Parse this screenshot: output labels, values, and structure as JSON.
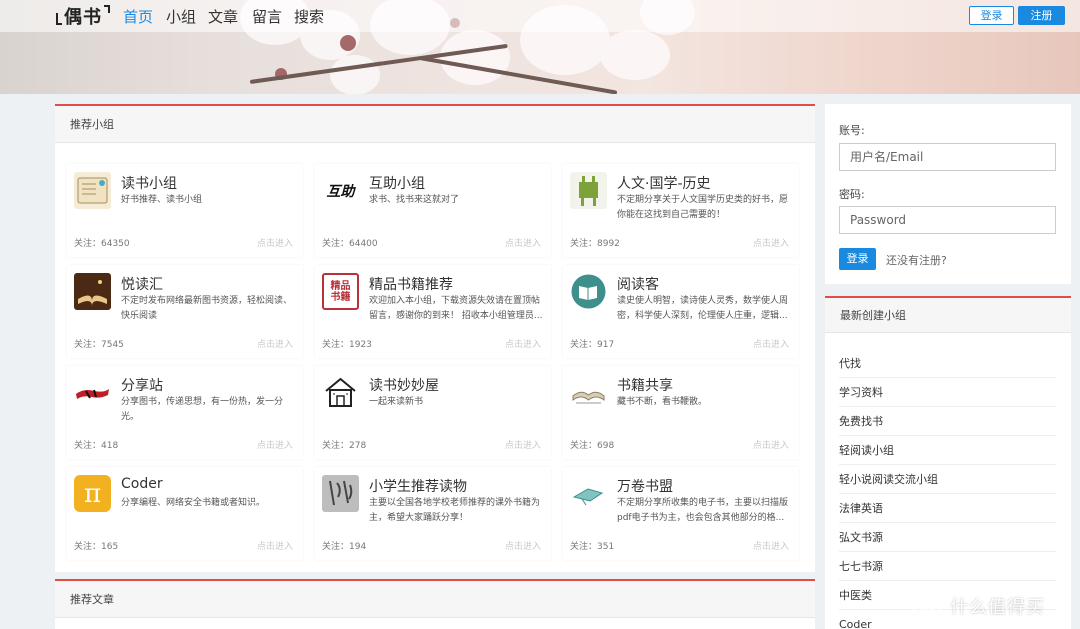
{
  "header": {
    "logo_text": "偶书",
    "nav": [
      "首页",
      "小组",
      "文章",
      "留言",
      "搜索"
    ],
    "login_label": "登录",
    "register_label": "注册"
  },
  "groups_panel": {
    "title": "推荐小组",
    "cards": [
      {
        "name": "读书小组",
        "desc": "好书推荐、读书小组",
        "follow": "关注：64350",
        "enter": "点击进入",
        "icon": "book-open-icon"
      },
      {
        "name": "互助小组",
        "desc": "求书、找书来这就对了",
        "follow": "关注：64400",
        "enter": "点击进入",
        "icon": "mutual-help-icon"
      },
      {
        "name": "人文·国学-历史",
        "desc": "不定期分享关于人文国学历史类的好书，愿你能在这找到自己需要的！",
        "follow": "关注：8992",
        "enter": "点击进入",
        "icon": "bronze-vessel-icon"
      },
      {
        "name": "悦读汇",
        "desc": "不定时发布网络最新图书资源，轻松阅读、快乐阅读",
        "follow": "关注：7545",
        "enter": "点击进入",
        "icon": "reading-book-icon"
      },
      {
        "name": "精品书籍推荐",
        "desc": "欢迎加入本小组，下载资源失效请在置顶帖留言，感谢你的到来！ 招收本小组管理员...",
        "follow": "关注：1923",
        "enter": "点击进入",
        "icon": "seal-stamp-icon"
      },
      {
        "name": "阅读客",
        "desc": "读史使人明智，读诗使人灵秀，数学使人周密，科学使人深刻，伦理使人庄重，逻辑...",
        "follow": "关注：917",
        "enter": "点击进入",
        "icon": "round-book-icon"
      },
      {
        "name": "分享站",
        "desc": "分享图书，传递思想，有一份热，发一分光。",
        "follow": "关注：418",
        "enter": "点击进入",
        "icon": "brush-stroke-icon"
      },
      {
        "name": "读书妙妙屋",
        "desc": "一起来读新书",
        "follow": "关注：278",
        "enter": "点击进入",
        "icon": "house-icon"
      },
      {
        "name": "书籍共享",
        "desc": "藏书不断，看书鞭散。",
        "follow": "关注：698",
        "enter": "点击进入",
        "icon": "open-book-icon"
      },
      {
        "name": "Coder",
        "desc": "分享编程、网络安全书籍或者知识。",
        "follow": "关注：165",
        "enter": "点击进入",
        "icon": "pi-icon"
      },
      {
        "name": "小学生推荐读物",
        "desc": "主要以全国各地学校老师推荐的课外书籍为主，希望大家踊跃分享！",
        "follow": "关注：194",
        "enter": "点击进入",
        "icon": "calligraphy-icon"
      },
      {
        "name": "万卷书盟",
        "desc": "不定期分享所收集的电子书，主要以扫描版pdf电子书为主，也会包含其他部分的格...",
        "follow": "关注：351",
        "enter": "点击进入",
        "icon": "flying-book-icon"
      }
    ]
  },
  "articles_panel": {
    "title": "推荐文章"
  },
  "login_form": {
    "account_label": "账号:",
    "account_placeholder": "用户名/Email",
    "password_label": "密码:",
    "password_placeholder": "Password",
    "login_button": "登录",
    "register_link": "还没有注册?"
  },
  "newest_panel": {
    "title": "最新创建小组",
    "items": [
      "代找",
      "学习资料",
      "免费找书",
      "轻阅读小组",
      "轻小说阅读交流小组",
      "法律英语",
      "弘文书源",
      "七七书源",
      "中医类",
      "Coder"
    ]
  },
  "watermark": {
    "icon": "值",
    "text": "什么值得买"
  },
  "colors": {
    "accent": "#1a8ae0",
    "panel_top": "#e24b4b"
  }
}
